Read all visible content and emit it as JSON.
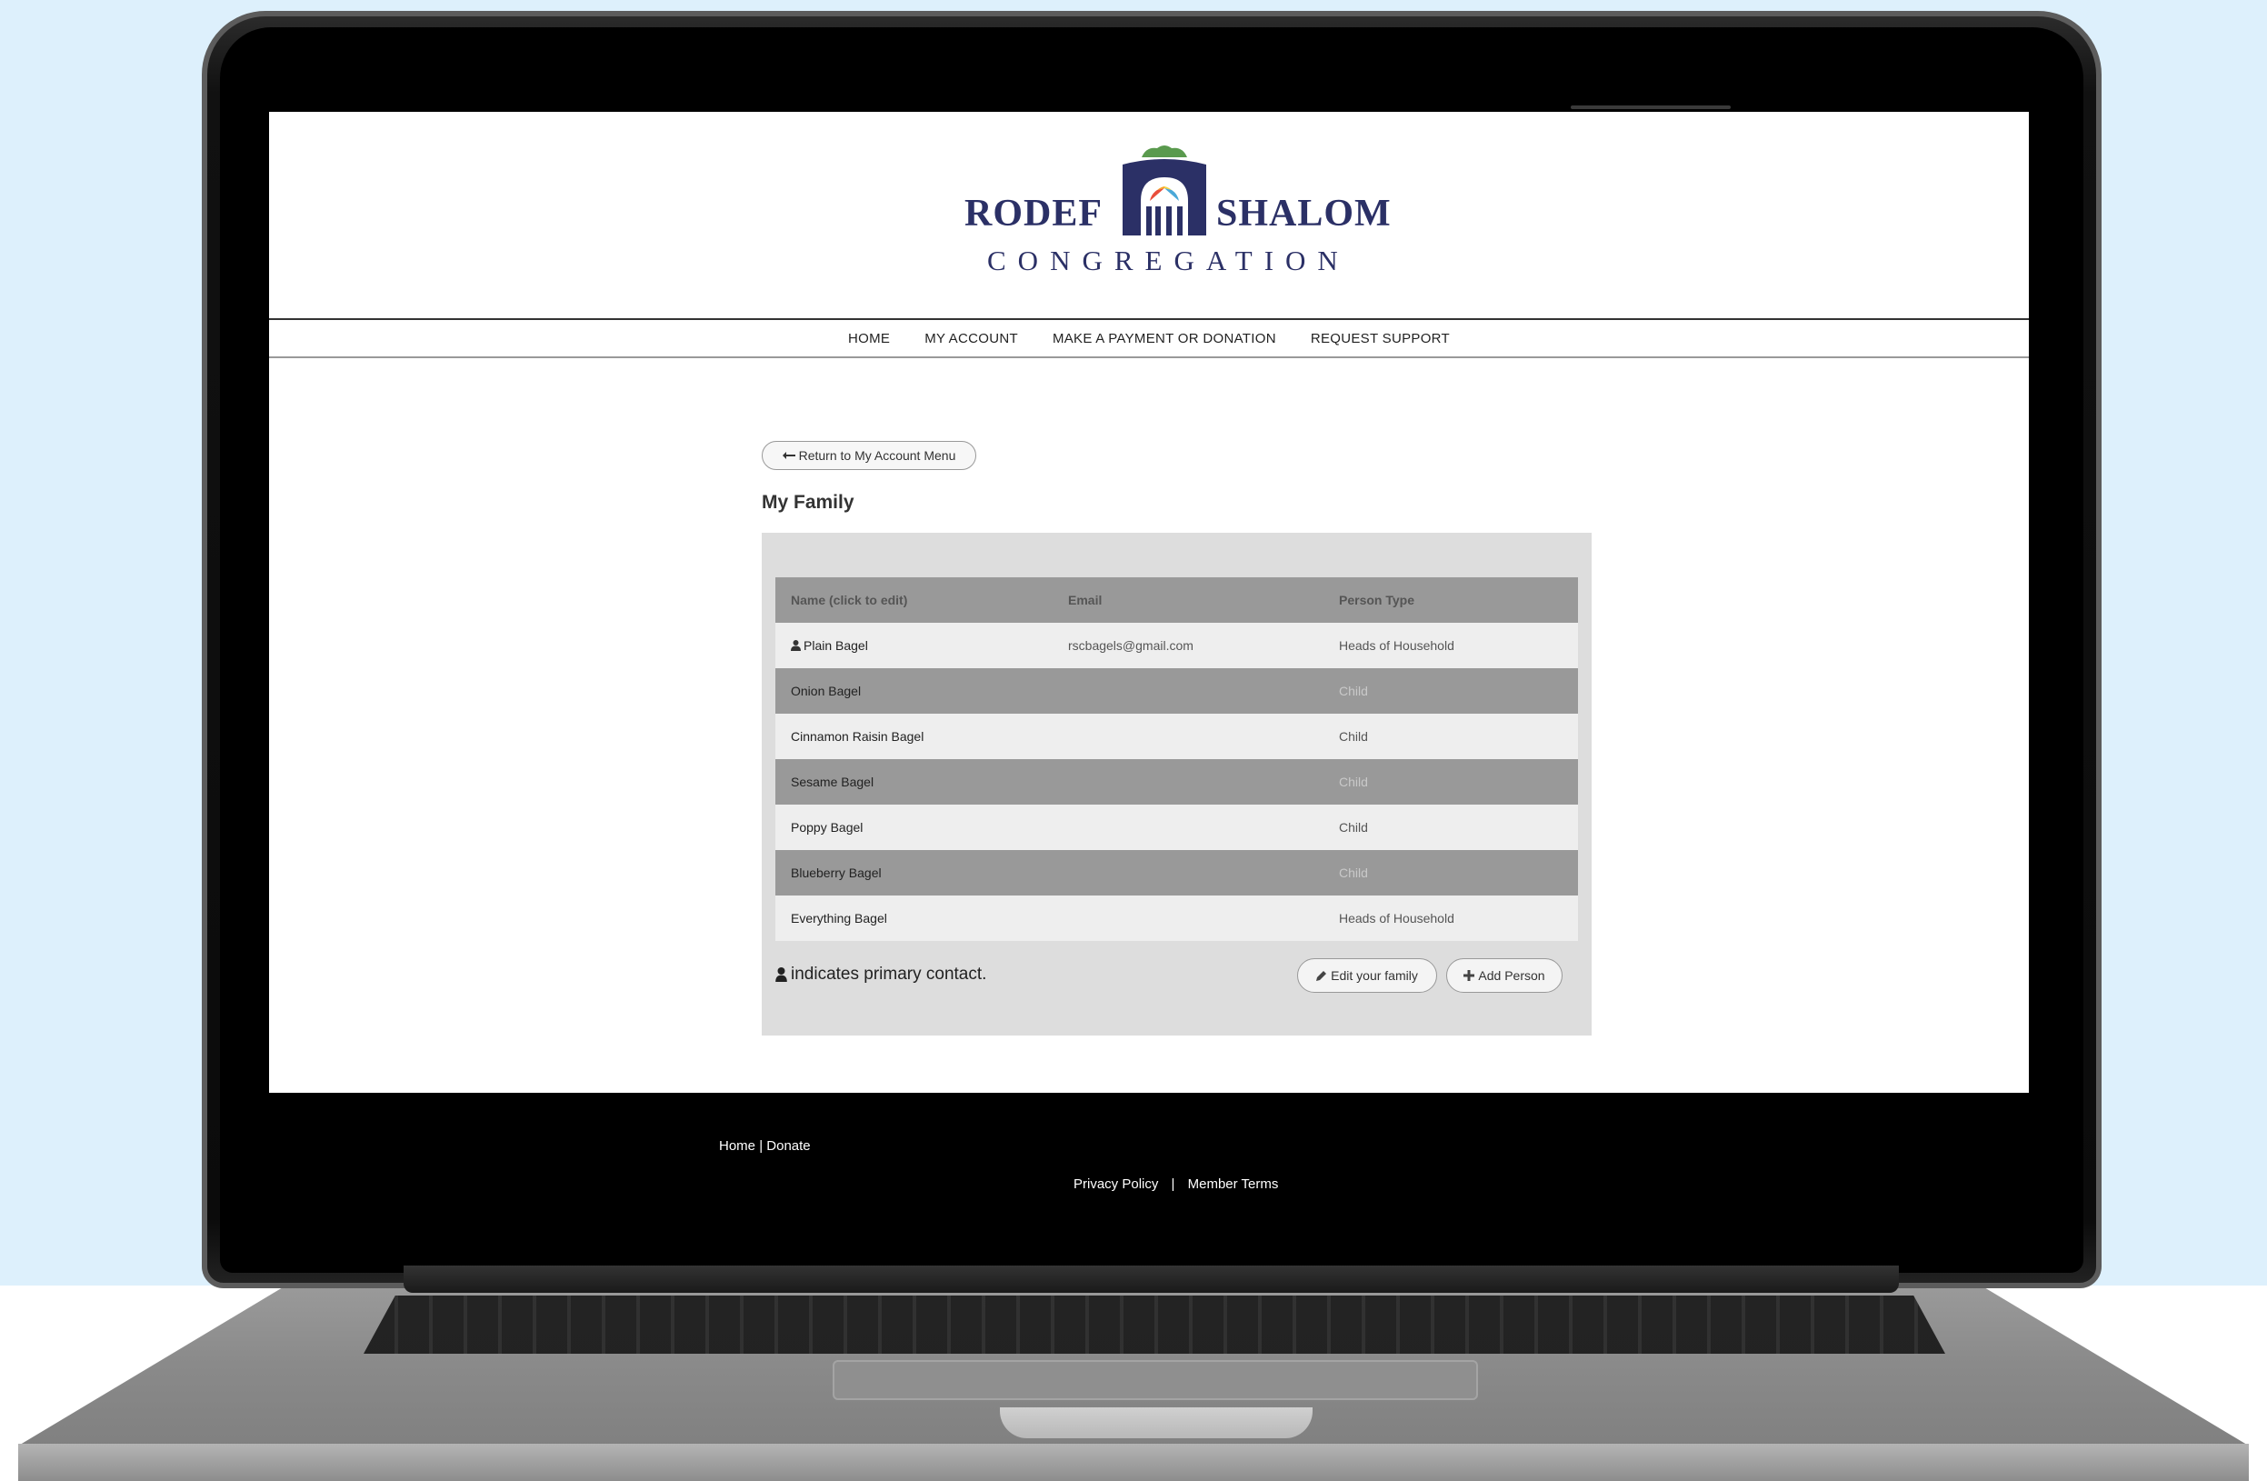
{
  "logo": {
    "word_left": "RODEF",
    "word_right": "SHALOM",
    "subtitle": "CONGREGATION",
    "colors": {
      "navy": "#2b3066",
      "green": "#5a9a4e"
    }
  },
  "nav": {
    "items": [
      "HOME",
      "MY ACCOUNT",
      "MAKE A PAYMENT OR DONATION",
      "REQUEST SUPPORT"
    ]
  },
  "back_button": {
    "icon": "arrow-left-icon",
    "label": "Return to My Account Menu"
  },
  "page_title": "My Family",
  "table": {
    "headers": {
      "name": "Name (click to edit)",
      "email": "Email",
      "type": "Person Type"
    },
    "rows": [
      {
        "name": "Plain Bagel",
        "email": "rscbagels@gmail.com",
        "type": "Heads of Household",
        "primary": true
      },
      {
        "name": "Onion Bagel",
        "email": "",
        "type": "Child"
      },
      {
        "name": "Cinnamon Raisin Bagel",
        "email": "",
        "type": "Child"
      },
      {
        "name": "Sesame Bagel",
        "email": "",
        "type": "Child"
      },
      {
        "name": "Poppy Bagel",
        "email": "",
        "type": "Child"
      },
      {
        "name": "Blueberry Bagel",
        "email": "",
        "type": "Child"
      },
      {
        "name": "Everything Bagel",
        "email": "",
        "type": "Heads of Household"
      }
    ]
  },
  "legend": {
    "icon": "user-icon",
    "text": "indicates primary contact."
  },
  "buttons": {
    "edit": {
      "icon": "pencil-icon",
      "label": "Edit your family"
    },
    "add": {
      "icon": "plus-icon",
      "label": "Add Person"
    }
  },
  "footer": {
    "home": "Home",
    "divider": "|",
    "donate": "Donate",
    "privacy": "Privacy Policy",
    "terms": "Member Terms"
  }
}
